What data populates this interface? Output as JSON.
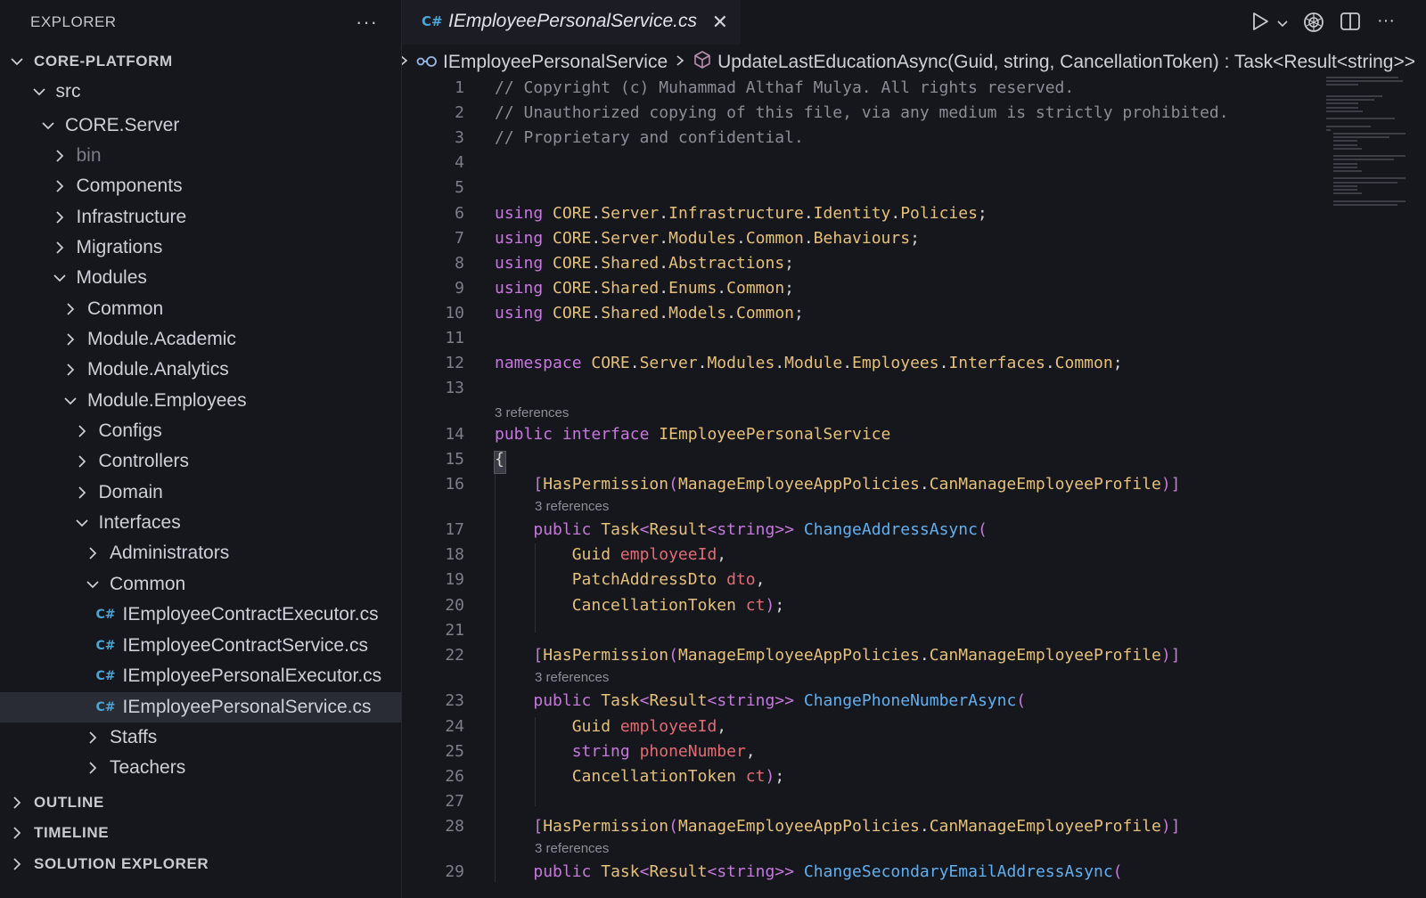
{
  "sidebar": {
    "title": "EXPLORER",
    "more": "···",
    "tree": [
      {
        "label": "CORE-PLATFORM",
        "kind": "root",
        "expanded": true
      },
      {
        "label": "src",
        "kind": "folder",
        "expanded": true
      },
      {
        "label": "CORE.Server",
        "kind": "folder",
        "expanded": true
      },
      {
        "label": "bin",
        "kind": "folder",
        "expanded": false,
        "dim": true
      },
      {
        "label": "Components",
        "kind": "folder",
        "expanded": false
      },
      {
        "label": "Infrastructure",
        "kind": "folder",
        "expanded": false
      },
      {
        "label": "Migrations",
        "kind": "folder",
        "expanded": false
      },
      {
        "label": "Modules",
        "kind": "folder",
        "expanded": true
      },
      {
        "label": "Common",
        "kind": "folder",
        "expanded": false
      },
      {
        "label": "Module.Academic",
        "kind": "folder",
        "expanded": false
      },
      {
        "label": "Module.Analytics",
        "kind": "folder",
        "expanded": false
      },
      {
        "label": "Module.Employees",
        "kind": "folder",
        "expanded": true
      },
      {
        "label": "Configs",
        "kind": "folder",
        "expanded": false
      },
      {
        "label": "Controllers",
        "kind": "folder",
        "expanded": false
      },
      {
        "label": "Domain",
        "kind": "folder",
        "expanded": false
      },
      {
        "label": "Interfaces",
        "kind": "folder",
        "expanded": true
      },
      {
        "label": "Administrators",
        "kind": "folder",
        "expanded": false
      },
      {
        "label": "Common",
        "kind": "folder",
        "expanded": true
      },
      {
        "label": "IEmployeeContractExecutor.cs",
        "kind": "file"
      },
      {
        "label": "IEmployeeContractService.cs",
        "kind": "file"
      },
      {
        "label": "IEmployeePersonalExecutor.cs",
        "kind": "file"
      },
      {
        "label": "IEmployeePersonalService.cs",
        "kind": "file",
        "selected": true
      },
      {
        "label": "Staffs",
        "kind": "folder",
        "expanded": false
      },
      {
        "label": "Teachers",
        "kind": "folder",
        "expanded": false
      }
    ],
    "sections": [
      "OUTLINE",
      "TIMELINE",
      "SOLUTION EXPLORER"
    ]
  },
  "editor": {
    "tab_label": "IEmployeePersonalService.cs",
    "file_icon_glyph": "C#",
    "close_glyph": "✕",
    "breadcrumb": {
      "interface": "IEmployeePersonalService",
      "method": "UpdateLastEducationAsync(Guid, string, CancellationToken) : Task<Result<string>>"
    },
    "codelens_text": "3 references",
    "lines": [
      {
        "n": "1",
        "text": "// Copyright (c) Muhammad Althaf Mulya. All rights reserved."
      },
      {
        "n": "2",
        "text": "// Unauthorized copying of this file, via any medium is strictly prohibited."
      },
      {
        "n": "3",
        "text": "// Proprietary and confidential."
      },
      {
        "n": "4",
        "text": ""
      },
      {
        "n": "5",
        "text": ""
      },
      {
        "n": "6",
        "text": "using CORE.Server.Infrastructure.Identity.Policies;"
      },
      {
        "n": "7",
        "text": "using CORE.Server.Modules.Common.Behaviours;"
      },
      {
        "n": "8",
        "text": "using CORE.Shared.Abstractions;"
      },
      {
        "n": "9",
        "text": "using CORE.Shared.Enums.Common;"
      },
      {
        "n": "10",
        "text": "using CORE.Shared.Models.Common;"
      },
      {
        "n": "11",
        "text": ""
      },
      {
        "n": "12",
        "text": "namespace CORE.Server.Modules.Module.Employees.Interfaces.Common;"
      },
      {
        "n": "13",
        "text": ""
      },
      {
        "n": "14",
        "text": "public interface IEmployeePersonalService"
      },
      {
        "n": "15",
        "text": "{"
      },
      {
        "n": "16",
        "text": "    [HasPermission(ManageEmployeeAppPolicies.CanManageEmployeeProfile)]"
      },
      {
        "n": "17",
        "text": "    public Task<Result<string>> ChangeAddressAsync("
      },
      {
        "n": "18",
        "text": "        Guid employeeId,"
      },
      {
        "n": "19",
        "text": "        PatchAddressDto dto,"
      },
      {
        "n": "20",
        "text": "        CancellationToken ct);"
      },
      {
        "n": "21",
        "text": ""
      },
      {
        "n": "22",
        "text": "    [HasPermission(ManageEmployeeAppPolicies.CanManageEmployeeProfile)]"
      },
      {
        "n": "23",
        "text": "    public Task<Result<string>> ChangePhoneNumberAsync("
      },
      {
        "n": "24",
        "text": "        Guid employeeId,"
      },
      {
        "n": "25",
        "text": "        string phoneNumber,"
      },
      {
        "n": "26",
        "text": "        CancellationToken ct);"
      },
      {
        "n": "27",
        "text": ""
      },
      {
        "n": "28",
        "text": "    [HasPermission(ManageEmployeeAppPolicies.CanManageEmployeeProfile)]"
      },
      {
        "n": "29",
        "text": "    public Task<Result<string>> ChangeSecondaryEmailAddressAsync("
      }
    ]
  },
  "icons": [
    "chevron-right-icon",
    "chevron-down-icon",
    "csharp-file-icon",
    "close-icon",
    "run-icon",
    "chevron-down-icon",
    "copilot-icon",
    "split-editor-icon",
    "more-icon",
    "symbol-interface-icon",
    "symbol-method-icon"
  ],
  "colors": {
    "keyword": "#c678dd",
    "type": "#e5c07b",
    "method": "#61afef",
    "parameter": "#e06c75",
    "comment": "#8a8d94",
    "csharp": "#4aa5d6"
  }
}
